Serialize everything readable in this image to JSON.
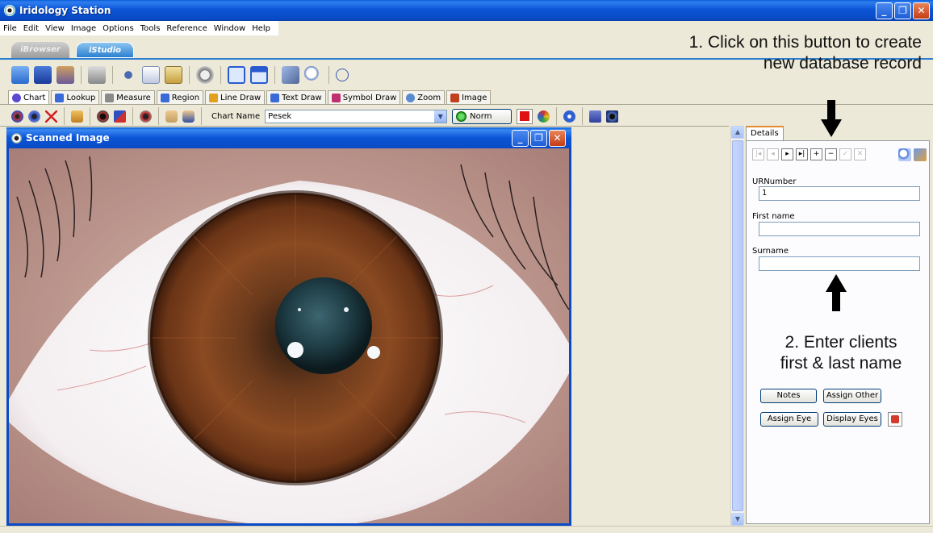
{
  "window": {
    "title": "Iridology Station",
    "min": "_",
    "max": "❐",
    "close": "✕"
  },
  "menu": [
    "File",
    "Edit",
    "View",
    "Image",
    "Options",
    "Tools",
    "Reference",
    "Window",
    "Help"
  ],
  "modes": {
    "browser": "iBrowser",
    "studio": "iStudio"
  },
  "tool_tabs": [
    {
      "label": "Chart",
      "icon": "eye-icon",
      "color": "#5a4ad0"
    },
    {
      "label": "Lookup",
      "icon": "table-icon",
      "color": "#3a6ad8"
    },
    {
      "label": "Measure",
      "icon": "ruler-icon",
      "color": "#7a7a7a"
    },
    {
      "label": "Region",
      "icon": "region-icon",
      "color": "#3a6ad8"
    },
    {
      "label": "Line Draw",
      "icon": "pencil-icon",
      "color": "#e0a020"
    },
    {
      "label": "Text Draw",
      "icon": "text-icon",
      "color": "#3a6ad8"
    },
    {
      "label": "Symbol Draw",
      "icon": "symbol-icon",
      "color": "#c03070"
    },
    {
      "label": "Zoom",
      "icon": "zoom-icon",
      "color": "#5a8ad0"
    },
    {
      "label": "Image",
      "icon": "image-icon",
      "color": "#c04020"
    }
  ],
  "chart_toolbar": {
    "chart_name_label": "Chart Name",
    "chart_name_value": "Pesek",
    "norm_label": "Norm"
  },
  "image_window": {
    "title": "Scanned Image"
  },
  "details": {
    "tab": "Details",
    "fields": [
      {
        "label": "URNumber",
        "value": "1"
      },
      {
        "label": "First name",
        "value": ""
      },
      {
        "label": "Surname",
        "value": ""
      }
    ],
    "buttons": {
      "notes": "Notes",
      "assign_other": "Assign Other",
      "assign_eye": "Assign Eye",
      "display_eyes": "Display Eyes"
    }
  },
  "annotations": {
    "step1_line1": "1. Click on this button to create",
    "step1_line2": "new database record",
    "step2_line1": "2. Enter clients",
    "step2_line2": "first & last name"
  }
}
